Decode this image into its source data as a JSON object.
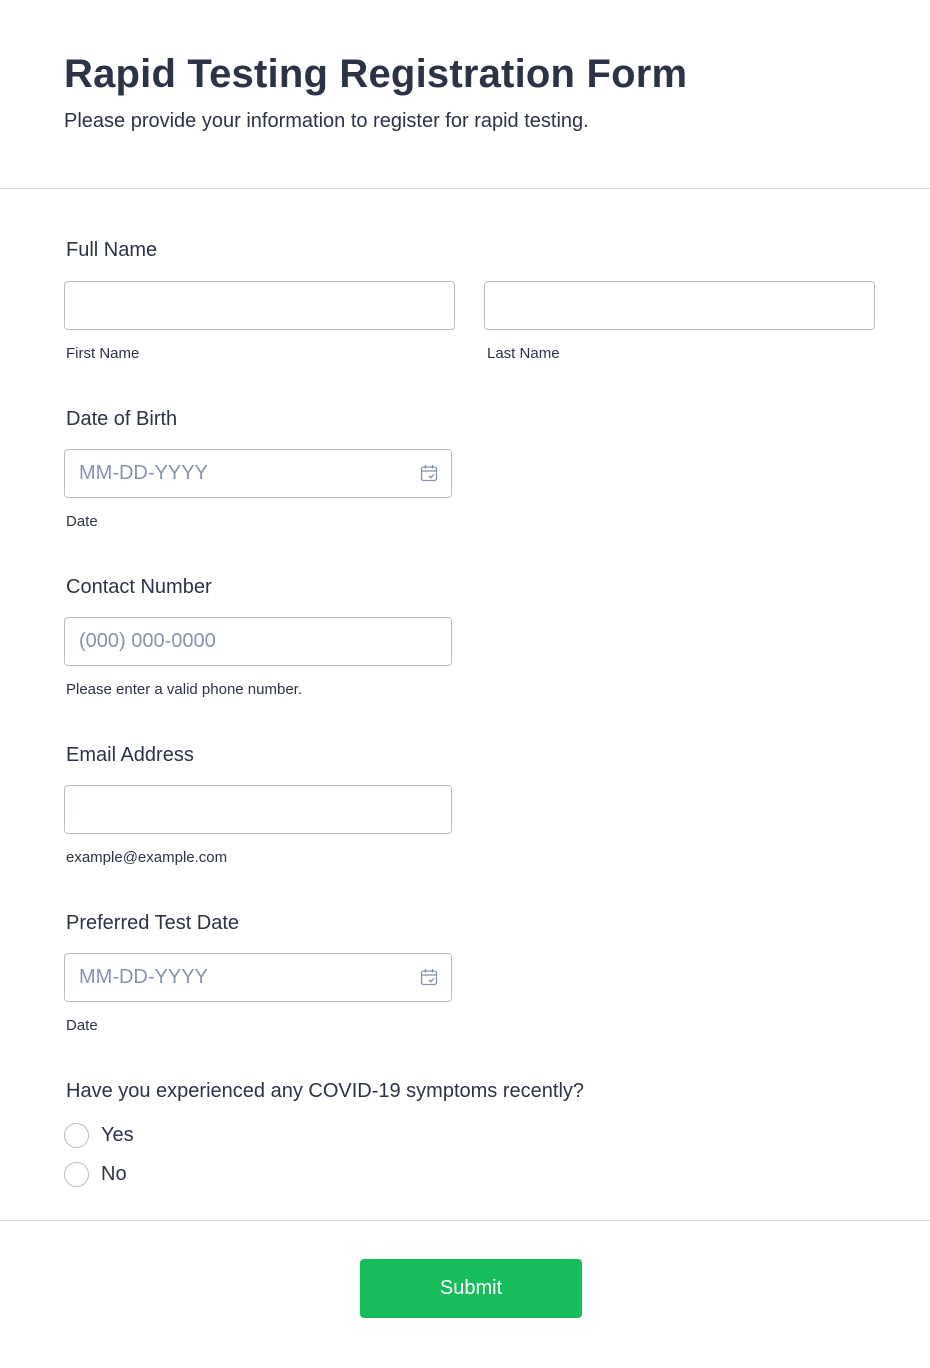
{
  "header": {
    "title": "Rapid Testing Registration Form",
    "subtitle": "Please provide your information to register for rapid testing."
  },
  "full_name": {
    "label": "Full Name",
    "first_sublabel": "First Name",
    "last_sublabel": "Last Name",
    "first_value": "",
    "last_value": ""
  },
  "dob": {
    "label": "Date of Birth",
    "placeholder": "MM-DD-YYYY",
    "sublabel": "Date",
    "icon": "calendar-icon"
  },
  "contact": {
    "label": "Contact Number",
    "placeholder": "(000) 000-0000",
    "sublabel": "Please enter a valid phone number."
  },
  "email": {
    "label": "Email Address",
    "value": "",
    "sublabel": "example@example.com"
  },
  "test_date": {
    "label": "Preferred Test Date",
    "placeholder": "MM-DD-YYYY",
    "sublabel": "Date",
    "icon": "calendar-icon"
  },
  "symptoms": {
    "label": "Have you experienced any COVID-19 symptoms recently?",
    "options": [
      "Yes",
      "No"
    ]
  },
  "submit": {
    "label": "Submit"
  },
  "colors": {
    "text": "#2c3345",
    "placeholder": "#8894ab",
    "border": "#b8bdc9",
    "submit": "#18bd5b"
  }
}
